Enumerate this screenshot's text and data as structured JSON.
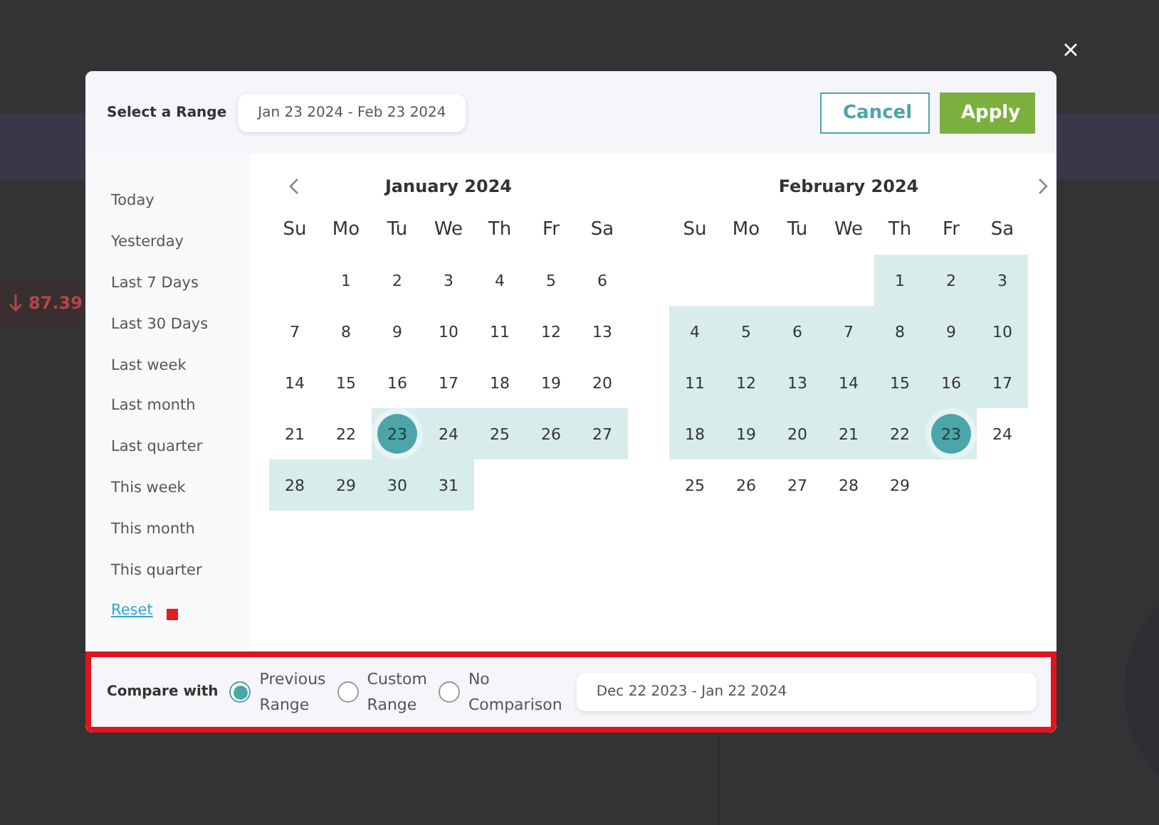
{
  "background": {
    "stat": "87.39"
  },
  "header": {
    "label": "Select a Range",
    "range": "Jan 23 2024 - Feb 23 2024",
    "buttons": [
      {
        "label": "Cancel",
        "kind": "secondary"
      },
      {
        "label": "Apply",
        "kind": "primary"
      }
    ]
  },
  "presets": [
    {
      "label": "Today",
      "kind": "item"
    },
    {
      "label": "Yesterday",
      "kind": "item"
    },
    {
      "label": "Last 7 Days",
      "kind": "item"
    },
    {
      "label": "Last 30 Days",
      "kind": "item"
    },
    {
      "label": "Last week",
      "kind": "item"
    },
    {
      "label": "Last month",
      "kind": "item"
    },
    {
      "label": "Last quarter",
      "kind": "item"
    },
    {
      "label": "This week",
      "kind": "item"
    },
    {
      "label": "This month",
      "kind": "item"
    },
    {
      "label": "This quarter",
      "kind": "item"
    },
    {
      "label": "Reset",
      "kind": "link"
    }
  ],
  "months": [
    {
      "title": "January 2024",
      "weekdays": [
        "Su",
        "Mo",
        "Tu",
        "We",
        "Th",
        "Fr",
        "Sa"
      ],
      "weeks": [
        [
          {
            "kind": "blank"
          },
          {
            "day": "1",
            "in_range": false,
            "endpoint": false
          },
          {
            "day": "2",
            "in_range": false,
            "endpoint": false
          },
          {
            "day": "3",
            "in_range": false,
            "endpoint": false
          },
          {
            "day": "4",
            "in_range": false,
            "endpoint": false
          },
          {
            "day": "5",
            "in_range": false,
            "endpoint": false
          },
          {
            "day": "6",
            "in_range": false,
            "endpoint": false
          }
        ],
        [
          {
            "day": "7",
            "in_range": false,
            "endpoint": false
          },
          {
            "day": "8",
            "in_range": false,
            "endpoint": false
          },
          {
            "day": "9",
            "in_range": false,
            "endpoint": false
          },
          {
            "day": "10",
            "in_range": false,
            "endpoint": false
          },
          {
            "day": "11",
            "in_range": false,
            "endpoint": false
          },
          {
            "day": "12",
            "in_range": false,
            "endpoint": false
          },
          {
            "day": "13",
            "in_range": false,
            "endpoint": false
          }
        ],
        [
          {
            "day": "14",
            "in_range": false,
            "endpoint": false
          },
          {
            "day": "15",
            "in_range": false,
            "endpoint": false
          },
          {
            "day": "16",
            "in_range": false,
            "endpoint": false
          },
          {
            "day": "17",
            "in_range": false,
            "endpoint": false
          },
          {
            "day": "18",
            "in_range": false,
            "endpoint": false
          },
          {
            "day": "19",
            "in_range": false,
            "endpoint": false
          },
          {
            "day": "20",
            "in_range": false,
            "endpoint": false
          }
        ],
        [
          {
            "day": "21",
            "in_range": false,
            "endpoint": false
          },
          {
            "day": "22",
            "in_range": false,
            "endpoint": false
          },
          {
            "day": "23",
            "in_range": true,
            "endpoint": true
          },
          {
            "day": "24",
            "in_range": true,
            "endpoint": false
          },
          {
            "day": "25",
            "in_range": true,
            "endpoint": false
          },
          {
            "day": "26",
            "in_range": true,
            "endpoint": false
          },
          {
            "day": "27",
            "in_range": true,
            "endpoint": false
          }
        ],
        [
          {
            "day": "28",
            "in_range": true,
            "endpoint": false
          },
          {
            "day": "29",
            "in_range": true,
            "endpoint": false
          },
          {
            "day": "30",
            "in_range": true,
            "endpoint": false
          },
          {
            "day": "31",
            "in_range": true,
            "endpoint": false
          },
          {
            "kind": "blank"
          },
          {
            "kind": "blank"
          },
          {
            "kind": "blank"
          }
        ]
      ]
    },
    {
      "title": "February 2024",
      "weekdays": [
        "Su",
        "Mo",
        "Tu",
        "We",
        "Th",
        "Fr",
        "Sa"
      ],
      "weeks": [
        [
          {
            "kind": "blank"
          },
          {
            "kind": "blank"
          },
          {
            "kind": "blank"
          },
          {
            "kind": "blank"
          },
          {
            "day": "1",
            "in_range": true,
            "endpoint": false
          },
          {
            "day": "2",
            "in_range": true,
            "endpoint": false
          },
          {
            "day": "3",
            "in_range": true,
            "endpoint": false
          }
        ],
        [
          {
            "day": "4",
            "in_range": true,
            "endpoint": false
          },
          {
            "day": "5",
            "in_range": true,
            "endpoint": false
          },
          {
            "day": "6",
            "in_range": true,
            "endpoint": false
          },
          {
            "day": "7",
            "in_range": true,
            "endpoint": false
          },
          {
            "day": "8",
            "in_range": true,
            "endpoint": false
          },
          {
            "day": "9",
            "in_range": true,
            "endpoint": false
          },
          {
            "day": "10",
            "in_range": true,
            "endpoint": false
          }
        ],
        [
          {
            "day": "11",
            "in_range": true,
            "endpoint": false
          },
          {
            "day": "12",
            "in_range": true,
            "endpoint": false
          },
          {
            "day": "13",
            "in_range": true,
            "endpoint": false
          },
          {
            "day": "14",
            "in_range": true,
            "endpoint": false
          },
          {
            "day": "15",
            "in_range": true,
            "endpoint": false
          },
          {
            "day": "16",
            "in_range": true,
            "endpoint": false
          },
          {
            "day": "17",
            "in_range": true,
            "endpoint": false
          }
        ],
        [
          {
            "day": "18",
            "in_range": true,
            "endpoint": false
          },
          {
            "day": "19",
            "in_range": true,
            "endpoint": false
          },
          {
            "day": "20",
            "in_range": true,
            "endpoint": false
          },
          {
            "day": "21",
            "in_range": true,
            "endpoint": false
          },
          {
            "day": "22",
            "in_range": true,
            "endpoint": false
          },
          {
            "day": "23",
            "in_range": true,
            "endpoint": true
          },
          {
            "day": "24",
            "in_range": false,
            "endpoint": false
          }
        ],
        [
          {
            "day": "25",
            "in_range": false,
            "endpoint": false
          },
          {
            "day": "26",
            "in_range": false,
            "endpoint": false
          },
          {
            "day": "27",
            "in_range": false,
            "endpoint": false
          },
          {
            "day": "28",
            "in_range": false,
            "endpoint": false
          },
          {
            "day": "29",
            "in_range": false,
            "endpoint": false
          },
          {
            "kind": "blank"
          },
          {
            "kind": "blank"
          }
        ]
      ]
    }
  ],
  "compare": {
    "label": "Compare with",
    "options": [
      {
        "lines": [
          "Previous",
          "Range"
        ],
        "selected": true
      },
      {
        "lines": [
          "Custom",
          "Range"
        ],
        "selected": false
      },
      {
        "lines": [
          "No",
          "Comparison"
        ],
        "selected": false
      }
    ],
    "range": "Dec 22 2023 - Jan 22 2024"
  }
}
